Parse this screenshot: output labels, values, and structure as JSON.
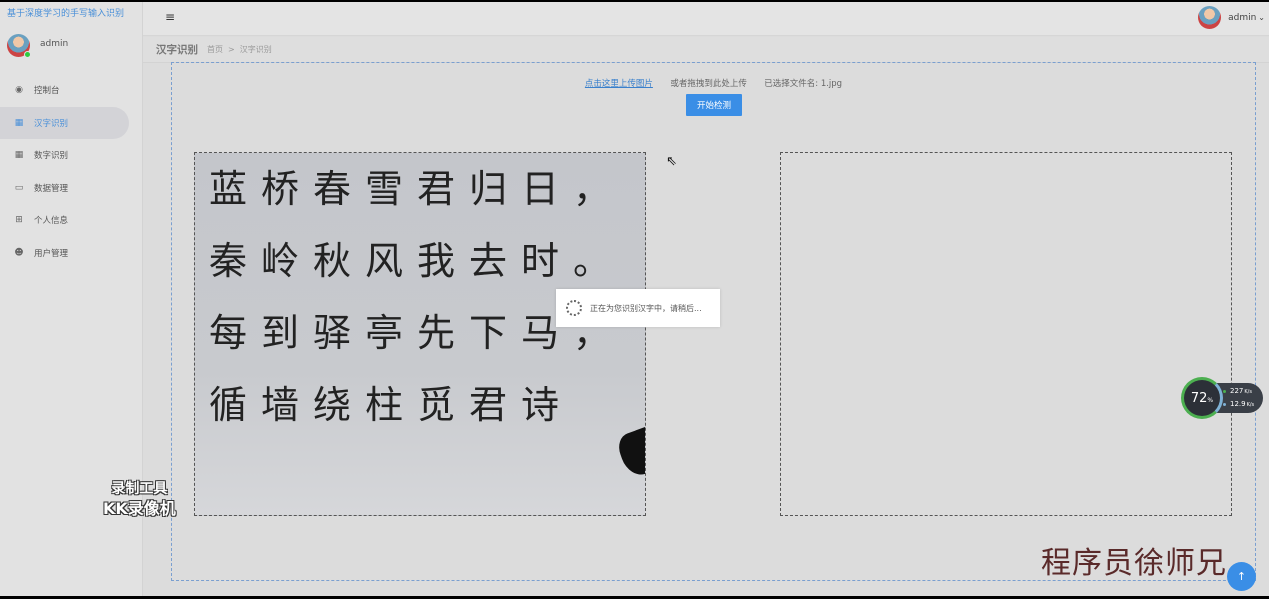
{
  "app": {
    "brand": "基于深度学习的手写输入识别"
  },
  "sidebar": {
    "user_name": "admin",
    "items": [
      {
        "label": "控制台",
        "icon": "dashboard-icon"
      },
      {
        "label": "汉字识别",
        "icon": "grid-icon",
        "active": true
      },
      {
        "label": "数字识别",
        "icon": "grid-icon"
      },
      {
        "label": "数据管理",
        "icon": "database-icon"
      },
      {
        "label": "个人信息",
        "icon": "table-icon"
      },
      {
        "label": "用户管理",
        "icon": "users-icon"
      }
    ]
  },
  "topbar": {
    "menu_icon": "≡",
    "user_name": "admin"
  },
  "header": {
    "title": "汉字识别",
    "breadcrumb": [
      "首页",
      "汉字识别"
    ],
    "breadcrumb_sep": ">"
  },
  "upload": {
    "link": "点击这里上传图片",
    "drag_hint": "或者拖拽到此处上传",
    "selected_label": "已选择文件名: 1.jpg",
    "start_button": "开始检测"
  },
  "image": {
    "lines": [
      "蓝桥春雪君归日，",
      "秦岭秋风我去时。",
      "每到驿亭先下马，",
      "循墙绕柱觅君诗"
    ]
  },
  "loading": {
    "text": "正在为您识别汉字中，请稍后..."
  },
  "overlays": {
    "recorder_line1": "录制工具",
    "recorder_line2": "KK录像机",
    "author": "程序员徐师兄",
    "net_percent": "72",
    "net_unit": "%",
    "net_up": "227",
    "net_down": "12.9",
    "net_rate_unit": "K/s",
    "fab": "↑"
  },
  "colors": {
    "accent": "#3a8ee6",
    "link": "#3a80cc",
    "active_bg": "#d3d3d7"
  }
}
